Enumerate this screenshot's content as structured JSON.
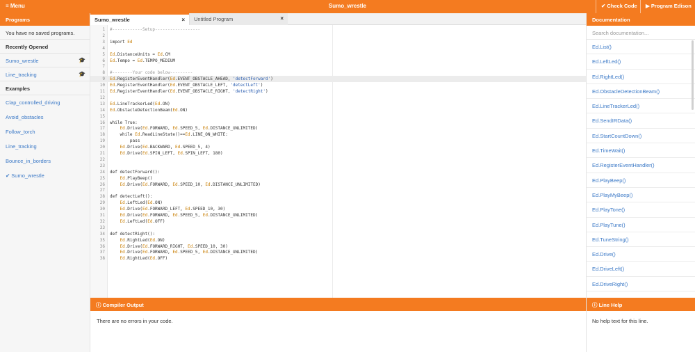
{
  "topbar": {
    "menu_label": "≡ Menu",
    "title": "Sumo_wrestle",
    "check_code_label": "✔ Check Code",
    "program_label": "▶ Program Edison"
  },
  "sidebar": {
    "programs_header": "Programs",
    "no_saved": "You have no saved programs.",
    "recently_opened_label": "Recently Opened",
    "recent": [
      "Sumo_wrestle",
      "Line_tracking"
    ],
    "examples_label": "Examples",
    "examples": [
      "Clap_controlled_driving",
      "Avoid_obstacles",
      "Follow_torch",
      "Line_tracking",
      "Bounce_in_borders",
      "Sumo_wrestle"
    ],
    "checked_example": "Sumo_wrestle"
  },
  "tabs": [
    {
      "label": "Sumo_wrestle",
      "close": "×"
    },
    {
      "label": "Untitled Program",
      "close": "×"
    }
  ],
  "editor": {
    "lines": [
      "#------------Setup------------------",
      "",
      "import Ed",
      "",
      "Ed.DistanceUnits = Ed.CM",
      "Ed.Tempo = Ed.TEMPO_MEDIUM",
      "",
      "#--------Your code below---------",
      "Ed.RegisterEventHandler(Ed.EVENT_OBSTACLE_AHEAD, 'detectForward')",
      "Ed.RegisterEventHandler(Ed.EVENT_OBSTACLE_LEFT, 'detectLeft')",
      "Ed.RegisterEventHandler(Ed.EVENT_OBSTACLE_RIGHT, 'detectRight')",
      "",
      "Ed.LineTrackerLed(Ed.ON)",
      "Ed.ObstacleDetectionBeam(Ed.ON)",
      "",
      "while True:",
      "    Ed.Drive(Ed.FORWARD, Ed.SPEED_5, Ed.DISTANCE_UNLIMITED)",
      "    while Ed.ReadLineState()==Ed.LINE_ON_WHITE:",
      "        pass",
      "    Ed.Drive(Ed.BACKWARD, Ed.SPEED_5, 4)",
      "    Ed.Drive(Ed.SPIN_LEFT, Ed.SPIN_LEFT, 180)",
      "",
      "",
      "def detectForward():",
      "    Ed.PlayBeep()",
      "    Ed.Drive(Ed.FORWARD, Ed.SPEED_10, Ed.DISTANCE_UNLIMITED)",
      "",
      "def detectLeft():",
      "    Ed.LeftLed(Ed.ON)",
      "    Ed.Drive(Ed.FORWARD_LEFT, Ed.SPEED_10, 30)",
      "    Ed.Drive(Ed.FORWARD, Ed.SPEED_5, Ed.DISTANCE_UNLIMITED)",
      "    Ed.LeftLed(Ed.OFF)",
      "",
      "def detectRight():",
      "    Ed.RightLed(Ed.ON)",
      "    Ed.Drive(Ed.FORWARD_RIGHT, Ed.SPEED_10, 30)",
      "    Ed.Drive(Ed.FORWARD, Ed.SPEED_5, Ed.DISTANCE_UNLIMITED)",
      "    Ed.RightLed(Ed.OFF)"
    ]
  },
  "documentation": {
    "header": "Documentation",
    "search_placeholder": "Search documentation...",
    "items": [
      "Ed.List()",
      "Ed.LeftLed()",
      "Ed.RightLed()",
      "Ed.ObstacleDetectionBeam()",
      "Ed.LineTrackerLed()",
      "Ed.SendIRData()",
      "Ed.StartCountDown()",
      "Ed.TimeWait()",
      "Ed.RegisterEventHandler()",
      "Ed.PlayBeep()",
      "Ed.PlayMyBeep()",
      "Ed.PlayTone()",
      "Ed.PlayTune()",
      "Ed.TuneString()",
      "Ed.Drive()",
      "Ed.DriveLeft()",
      "Ed.DriveRight()"
    ]
  },
  "compiler": {
    "header": "ⓘ Compiler Output",
    "message": "There are no errors in your code."
  },
  "linehelp": {
    "header": "ⓘ Line Help",
    "message": "No help text for this line."
  },
  "colors": {
    "accent": "#f47b20",
    "link": "#3a78c6"
  }
}
